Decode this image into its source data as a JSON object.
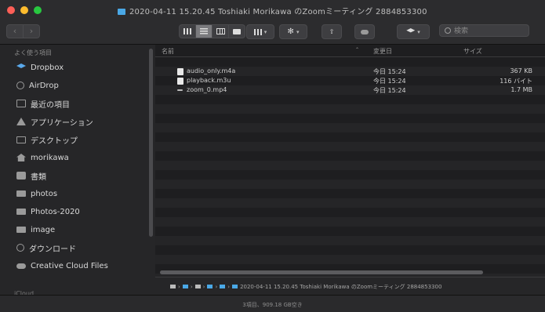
{
  "window": {
    "title": "2020-04-11 15.20.45 Toshiaki Morikawa のZoomミーティング 2884853300"
  },
  "search": {
    "placeholder": "検索"
  },
  "sidebar": {
    "section_label": "よく使う項目",
    "items": [
      {
        "label": "Dropbox",
        "icon": "dropbox-icon"
      },
      {
        "label": "AirDrop",
        "icon": "airdrop-icon"
      },
      {
        "label": "最近の項目",
        "icon": "recent-icon"
      },
      {
        "label": "アプリケーション",
        "icon": "applications-icon"
      },
      {
        "label": "デスクトップ",
        "icon": "desktop-icon"
      },
      {
        "label": "morikawa",
        "icon": "home-icon"
      },
      {
        "label": "書類",
        "icon": "documents-icon"
      },
      {
        "label": "photos",
        "icon": "folder-icon"
      },
      {
        "label": "Photos-2020",
        "icon": "folder-icon"
      },
      {
        "label": "image",
        "icon": "folder-icon"
      },
      {
        "label": "ダウンロード",
        "icon": "downloads-icon"
      },
      {
        "label": "Creative Cloud Files",
        "icon": "cloud-icon"
      }
    ],
    "footer_label": "iCloud"
  },
  "columns": {
    "name": "名前",
    "date": "変更日",
    "size": "サイズ"
  },
  "files": [
    {
      "name": "audio_only.m4a",
      "date": "今日 15:24",
      "size": "367 KB",
      "icon": "audio-file-icon"
    },
    {
      "name": "playback.m3u",
      "date": "今日 15:24",
      "size": "116 バイト",
      "icon": "document-file-icon"
    },
    {
      "name": "zoom_0.mp4",
      "date": "今日 15:24",
      "size": "1.7 MB",
      "icon": "video-file-icon"
    }
  ],
  "pathbar": {
    "text": "2020-04-11 15.20.45 Toshiaki Morikawa のZoomミーティング 2884853300"
  },
  "status": {
    "text": "3項目、909.18 GB空き"
  }
}
